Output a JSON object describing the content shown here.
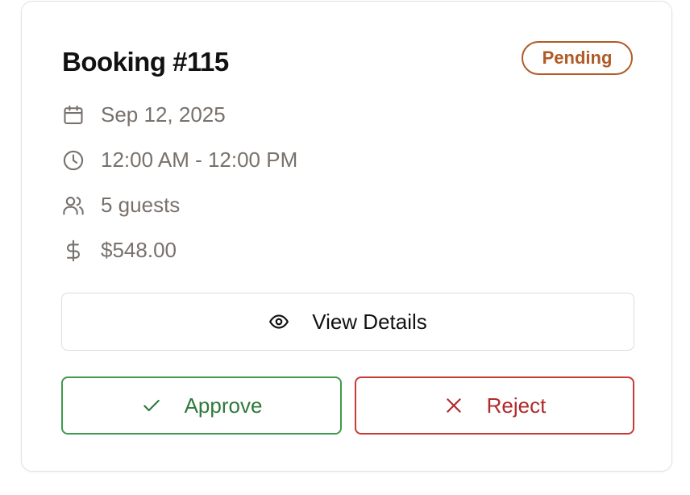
{
  "booking": {
    "title": "Booking #115",
    "status": "Pending",
    "date": "Sep 12, 2025",
    "time": "12:00 AM - 12:00 PM",
    "guests": "5 guests",
    "price": "$548.00"
  },
  "actions": {
    "view_details": "View Details",
    "approve": "Approve",
    "reject": "Reject"
  },
  "icons": [
    "calendar-icon",
    "clock-icon",
    "users-icon",
    "dollar-icon",
    "eye-icon",
    "check-icon",
    "x-icon"
  ],
  "colors": {
    "pending": "#b05a25",
    "approve": "#2f7a3b",
    "reject": "#b02a2a",
    "muted": "#78716c"
  }
}
